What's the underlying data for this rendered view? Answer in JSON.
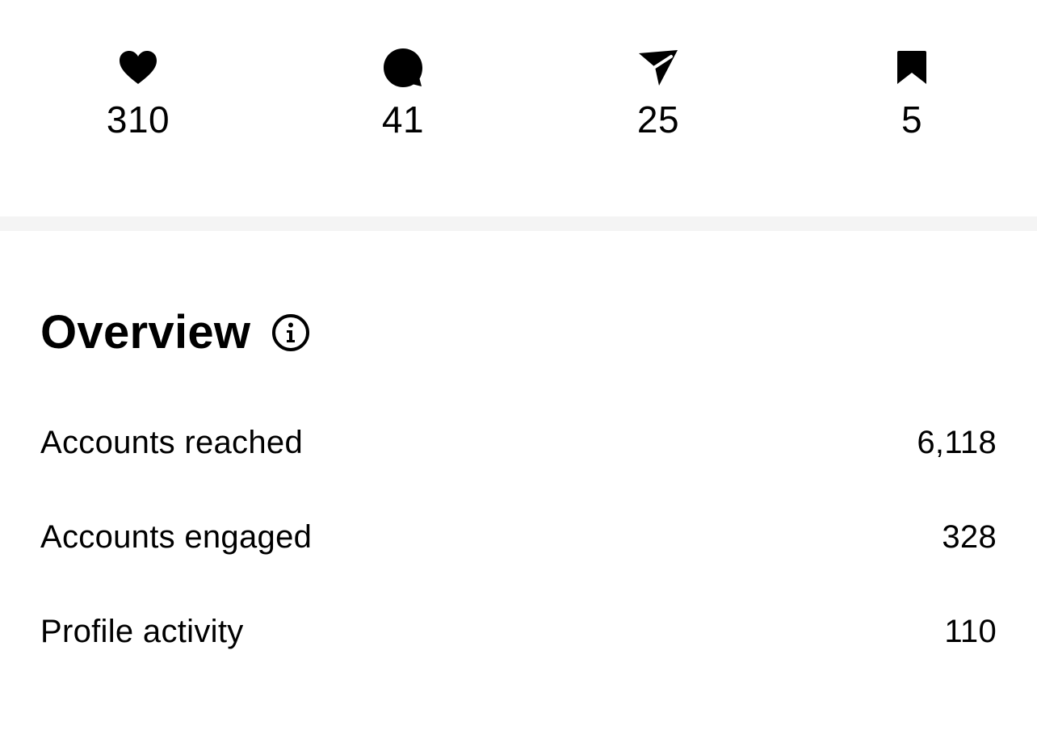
{
  "stats": [
    {
      "icon": "heart-icon",
      "count": "310"
    },
    {
      "icon": "comment-icon",
      "count": "41"
    },
    {
      "icon": "share-icon",
      "count": "25"
    },
    {
      "icon": "bookmark-icon",
      "count": "5"
    }
  ],
  "overview": {
    "title": "Overview",
    "info_icon": "info-icon",
    "metrics": [
      {
        "label": "Accounts reached",
        "value": "6,118"
      },
      {
        "label": "Accounts engaged",
        "value": "328"
      },
      {
        "label": "Profile activity",
        "value": "110"
      }
    ]
  },
  "colors": {
    "background": "#ffffff",
    "text": "#000000",
    "divider": "#f4f4f4"
  }
}
